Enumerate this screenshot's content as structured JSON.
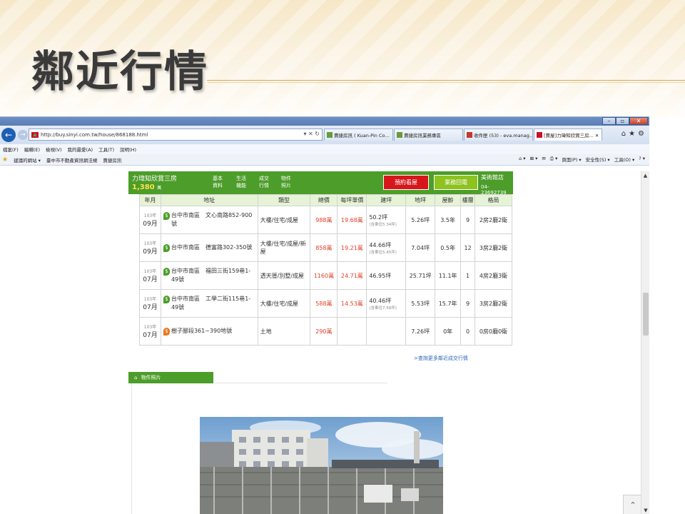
{
  "slide": {
    "title": "鄰近行情"
  },
  "browser": {
    "url": "http://buy.sinyi.com.tw/house/868188.html",
    "address_controls": "▾ ✕ ↻",
    "tabs": [
      {
        "label": "賣捷房訊 ( Kuan-Pin Co...",
        "icon_color": "#6a9a3a"
      },
      {
        "label": "賣捷房訊業務專區",
        "icon_color": "#6a9a3a"
      },
      {
        "label": "收件匣 (53) - eva.manag...",
        "icon_color": "#c0392b"
      },
      {
        "label": "[賣屋]力瑋知欣賞三房... ✕",
        "icon_color": "#c8102e"
      }
    ],
    "menu": [
      "檔案(F)",
      "編輯(E)",
      "檢視(V)",
      "我的最愛(A)",
      "工具(T)",
      "說明(H)"
    ],
    "favorites": [
      "建議的網站 ▾",
      "臺中市不動產資訊網法規",
      "賣捷房訊"
    ],
    "commands": [
      "頁面(P) ▾",
      "安全性(S) ▾",
      "工具(O) ▾"
    ]
  },
  "listing": {
    "name": "力瑋知欣賞三房",
    "price": "1,380",
    "price_unit": "萬",
    "nav": [
      {
        "l1": "基本",
        "l2": "資料"
      },
      {
        "l1": "生活",
        "l2": "機能"
      },
      {
        "l1": "成交",
        "l2": "行情"
      },
      {
        "l1": "物件",
        "l2": "照片"
      }
    ],
    "btn_visit": "預約看屋",
    "btn_call": "業務回電",
    "store": "美術館店",
    "tel": "04-23692739"
  },
  "deals": {
    "headers": [
      "年月",
      "地址",
      "類型",
      "總價",
      "每坪單價",
      "建坪",
      "地坪",
      "屋齡",
      "樓層",
      "格局"
    ],
    "rows": [
      {
        "y": "103年",
        "m": "09月",
        "addr": "台中市南區　文心南路852-900號",
        "pin": "green",
        "type": "大樓/住宅/成屋",
        "total": "988萬",
        "unit": "19.68萬",
        "build": "50.2坪",
        "build_sub": "(含車位5.34坪)",
        "land": "5.26坪",
        "age": "3.5年",
        "floor": "9",
        "layout": "2房2廳2衛"
      },
      {
        "y": "103年",
        "m": "09月",
        "addr": "台中市南區　德富路302-350號",
        "pin": "green",
        "type": "大樓/住宅/成屋/新屋",
        "total": "858萬",
        "unit": "19.21萬",
        "build": "44.66坪",
        "build_sub": "(含車位5.45坪)",
        "land": "7.04坪",
        "age": "0.5年",
        "floor": "12",
        "layout": "3房2廳2衛"
      },
      {
        "y": "103年",
        "m": "07月",
        "addr": "台中市南區　福田三街159巷1-49號",
        "pin": "green",
        "type": "透天厝/別墅/成屋",
        "total": "1160萬",
        "unit": "24.71萬",
        "build": "46.95坪",
        "build_sub": "",
        "land": "25.71坪",
        "age": "11.1年",
        "floor": "1",
        "layout": "4房2廳3衛"
      },
      {
        "y": "103年",
        "m": "07月",
        "addr": "台中市南區　工學二街115巷1-49號",
        "pin": "green",
        "type": "大樓/住宅/成屋",
        "total": "588萬",
        "unit": "14.53萬",
        "build": "40.46坪",
        "build_sub": "(含車位7.58坪)",
        "land": "5.53坪",
        "age": "15.7年",
        "floor": "9",
        "layout": "3房2廳2衛"
      },
      {
        "y": "103年",
        "m": "07月",
        "addr": "樹子腳段361~390地號",
        "pin": "orange",
        "type": "土地",
        "total": "290萬",
        "unit": "",
        "build": "",
        "build_sub": "",
        "land": "7.26坪",
        "age": "0年",
        "floor": "0",
        "layout": "0房0廳0衛"
      }
    ],
    "more_link": ">查詢更多鄰近成交行情"
  },
  "photos": {
    "section_title": "物件照片"
  }
}
